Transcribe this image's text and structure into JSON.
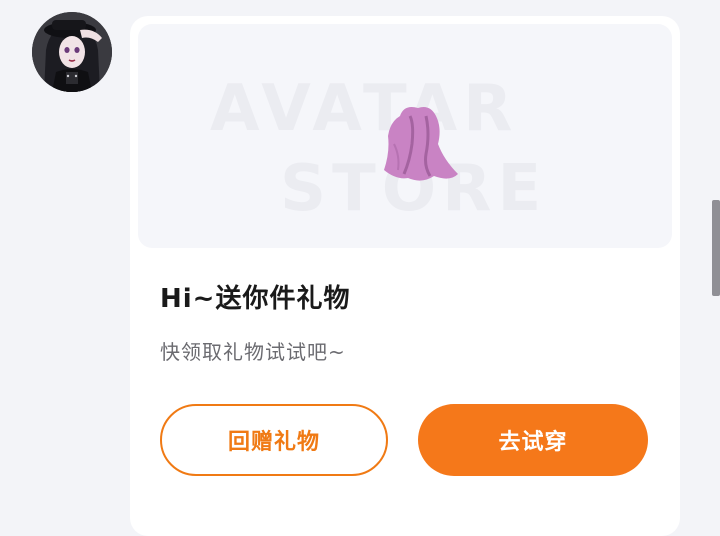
{
  "sender": {
    "avatar_icon": "user-avatar-icon"
  },
  "gift_card": {
    "banner": {
      "watermark_line1": "AVATAR",
      "watermark_line2": "STORE",
      "item_icon": "cape-garment-icon",
      "item_color": "#c983c4"
    },
    "title": "Hi~送你件礼物",
    "subtitle": "快领取礼物试试吧~",
    "return_gift_label": "回赠礼物",
    "try_on_label": "去试穿",
    "accent_color": "#f5781a"
  }
}
